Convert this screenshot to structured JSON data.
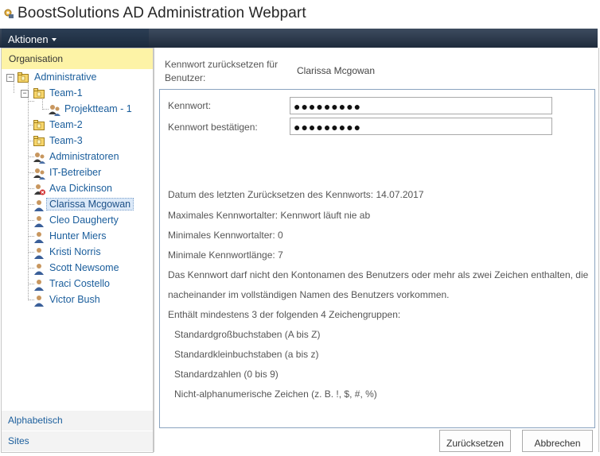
{
  "app": {
    "title": "BoostSolutions AD Administration Webpart",
    "logo_icon": "gear-lock-icon"
  },
  "ribbon": {
    "aktionen_label": "Aktionen"
  },
  "left_panel": {
    "header": "Organisation",
    "tree": [
      {
        "label": "Administrative",
        "icon": "ou-folder-icon",
        "expander": "−"
      },
      {
        "label": "Team-1",
        "icon": "ou-folder-icon",
        "expander": "−"
      },
      {
        "label": "Projektteam - 1",
        "icon": "group-icon"
      },
      {
        "label": "Team-2",
        "icon": "ou-folder-icon"
      },
      {
        "label": "Team-3",
        "icon": "ou-folder-icon"
      },
      {
        "label": "Administratoren",
        "icon": "group-icon"
      },
      {
        "label": "IT-Betreiber",
        "icon": "group-icon"
      },
      {
        "label": "Ava Dickinson",
        "icon": "disabled-user-icon"
      },
      {
        "label": "Clarissa Mcgowan",
        "icon": "user-icon",
        "selected": true
      },
      {
        "label": "Cleo Daugherty",
        "icon": "user-icon"
      },
      {
        "label": "Hunter Miers",
        "icon": "user-icon"
      },
      {
        "label": "Kristi Norris",
        "icon": "user-icon"
      },
      {
        "label": "Scott Newsome",
        "icon": "user-icon"
      },
      {
        "label": "Traci Costello",
        "icon": "user-icon"
      },
      {
        "label": "Victor Bush",
        "icon": "user-icon"
      }
    ],
    "tabs": {
      "alphabetisch": "Alphabetisch",
      "sites": "Sites"
    }
  },
  "reset_form": {
    "for_user_label_line1": "Kennwort zurücksetzen für",
    "for_user_label_line2": "Benutzer:",
    "user_name": "Clarissa Mcgowan",
    "password_label": "Kennwort:",
    "password_value": "●●●●●●●●●",
    "confirm_label": "Kennwort bestätigen:",
    "confirm_value": "●●●●●●●●●",
    "policy": {
      "last_reset": "Datum des letzten Zurücksetzen des Kennworts: 14.07.2017",
      "max_age": "Maximales Kennwortalter: Kennwort läuft nie ab",
      "min_age": "Minimales Kennwortalter: 0",
      "min_length": "Minimale Kennwortlänge: 7",
      "rule_line1": "Das Kennwort darf nicht den Kontonamen des Benutzers oder mehr als zwei Zeichen enthalten, die",
      "rule_line2": "nacheinander im vollständigen Namen des Benutzers vorkommen.",
      "groups_intro": "Enthält mindestens 3 der folgenden 4 Zeichengruppen:",
      "groups": [
        "Standardgroßbuchstaben (A bis Z)",
        "Standardkleinbuchstaben (a bis z)",
        "Standardzahlen (0 bis 9)",
        "Nicht-alphanumerische Zeichen (z. B. !, $, #, %)"
      ]
    },
    "buttons": {
      "reset": "Zurücksetzen",
      "cancel": "Abbrechen"
    }
  },
  "colors": {
    "link": "#1b5e9c",
    "header_highlight": "#fdf3a6",
    "ribbon": "#1f2b3c"
  }
}
